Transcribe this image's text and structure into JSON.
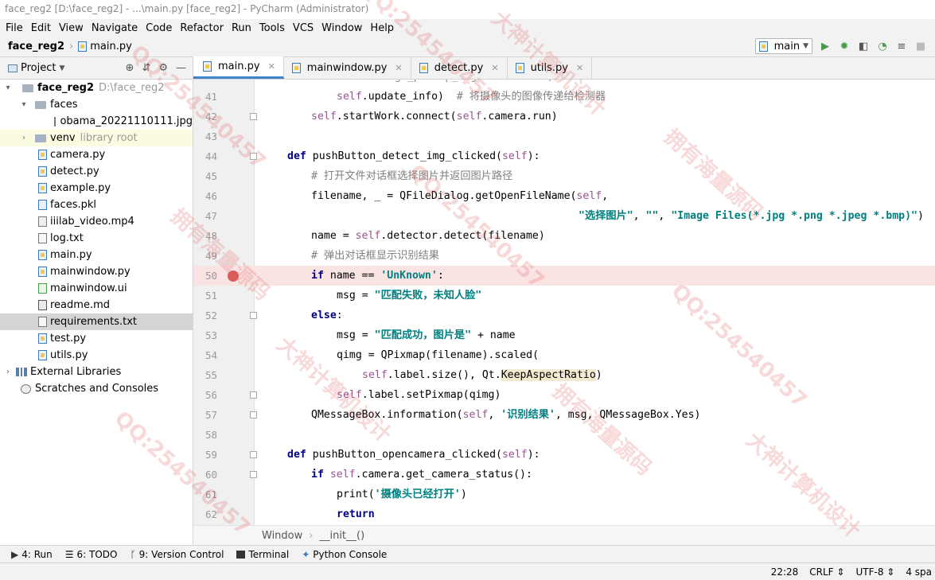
{
  "title": "face_reg2 [D:\\face_reg2] - ...\\main.py [face_reg2] - PyCharm (Administrator)",
  "menu": [
    "File",
    "Edit",
    "View",
    "Navigate",
    "Code",
    "Refactor",
    "Run",
    "Tools",
    "VCS",
    "Window",
    "Help"
  ],
  "breadcrumb": {
    "project": "face_reg2",
    "file": "main.py"
  },
  "run_config": "main",
  "sidebar": {
    "header": "Project",
    "items": [
      {
        "label": "face_reg2",
        "extra": "D:\\face_reg2",
        "type": "root"
      },
      {
        "label": "faces",
        "type": "dir"
      },
      {
        "label": "obama_20221110111.jpg",
        "type": "file"
      },
      {
        "label": "venv",
        "extra": "library root",
        "type": "venv"
      },
      {
        "label": "camera.py",
        "type": "py"
      },
      {
        "label": "detect.py",
        "type": "py"
      },
      {
        "label": "example.py",
        "type": "py"
      },
      {
        "label": "faces.pkl",
        "type": "file"
      },
      {
        "label": "iiilab_video.mp4",
        "type": "file"
      },
      {
        "label": "log.txt",
        "type": "file"
      },
      {
        "label": "main.py",
        "type": "py"
      },
      {
        "label": "mainwindow.py",
        "type": "py"
      },
      {
        "label": "mainwindow.ui",
        "type": "file"
      },
      {
        "label": "readme.md",
        "type": "file"
      },
      {
        "label": "requirements.txt",
        "type": "file"
      },
      {
        "label": "test.py",
        "type": "py"
      },
      {
        "label": "utils.py",
        "type": "py"
      },
      {
        "label": "External Libraries",
        "type": "lib"
      },
      {
        "label": "Scratches and Consoles",
        "type": "lib"
      }
    ]
  },
  "tabs": [
    "main.py",
    "mainwindow.py",
    "detect.py",
    "utils.py"
  ],
  "code_lines": [
    "41",
    "42",
    "43",
    "44",
    "45",
    "46",
    "47",
    "48",
    "49",
    "50",
    "51",
    "52",
    "53",
    "54",
    "55",
    "56",
    "57",
    "58",
    "59",
    "60",
    "61",
    "62"
  ],
  "editor_crumb": [
    "Window",
    "__init__()"
  ],
  "bottom_tools": [
    "4: Run",
    "6: TODO",
    "9: Version Control",
    "Terminal",
    "Python Console"
  ],
  "status": {
    "position": "22:28",
    "line_sep": "CRLF",
    "encoding": "UTF-8",
    "indent": "4 spa"
  },
  "watermarks": [
    "QQ:254540457",
    "大神计算机设计",
    "拥有海量源码"
  ]
}
